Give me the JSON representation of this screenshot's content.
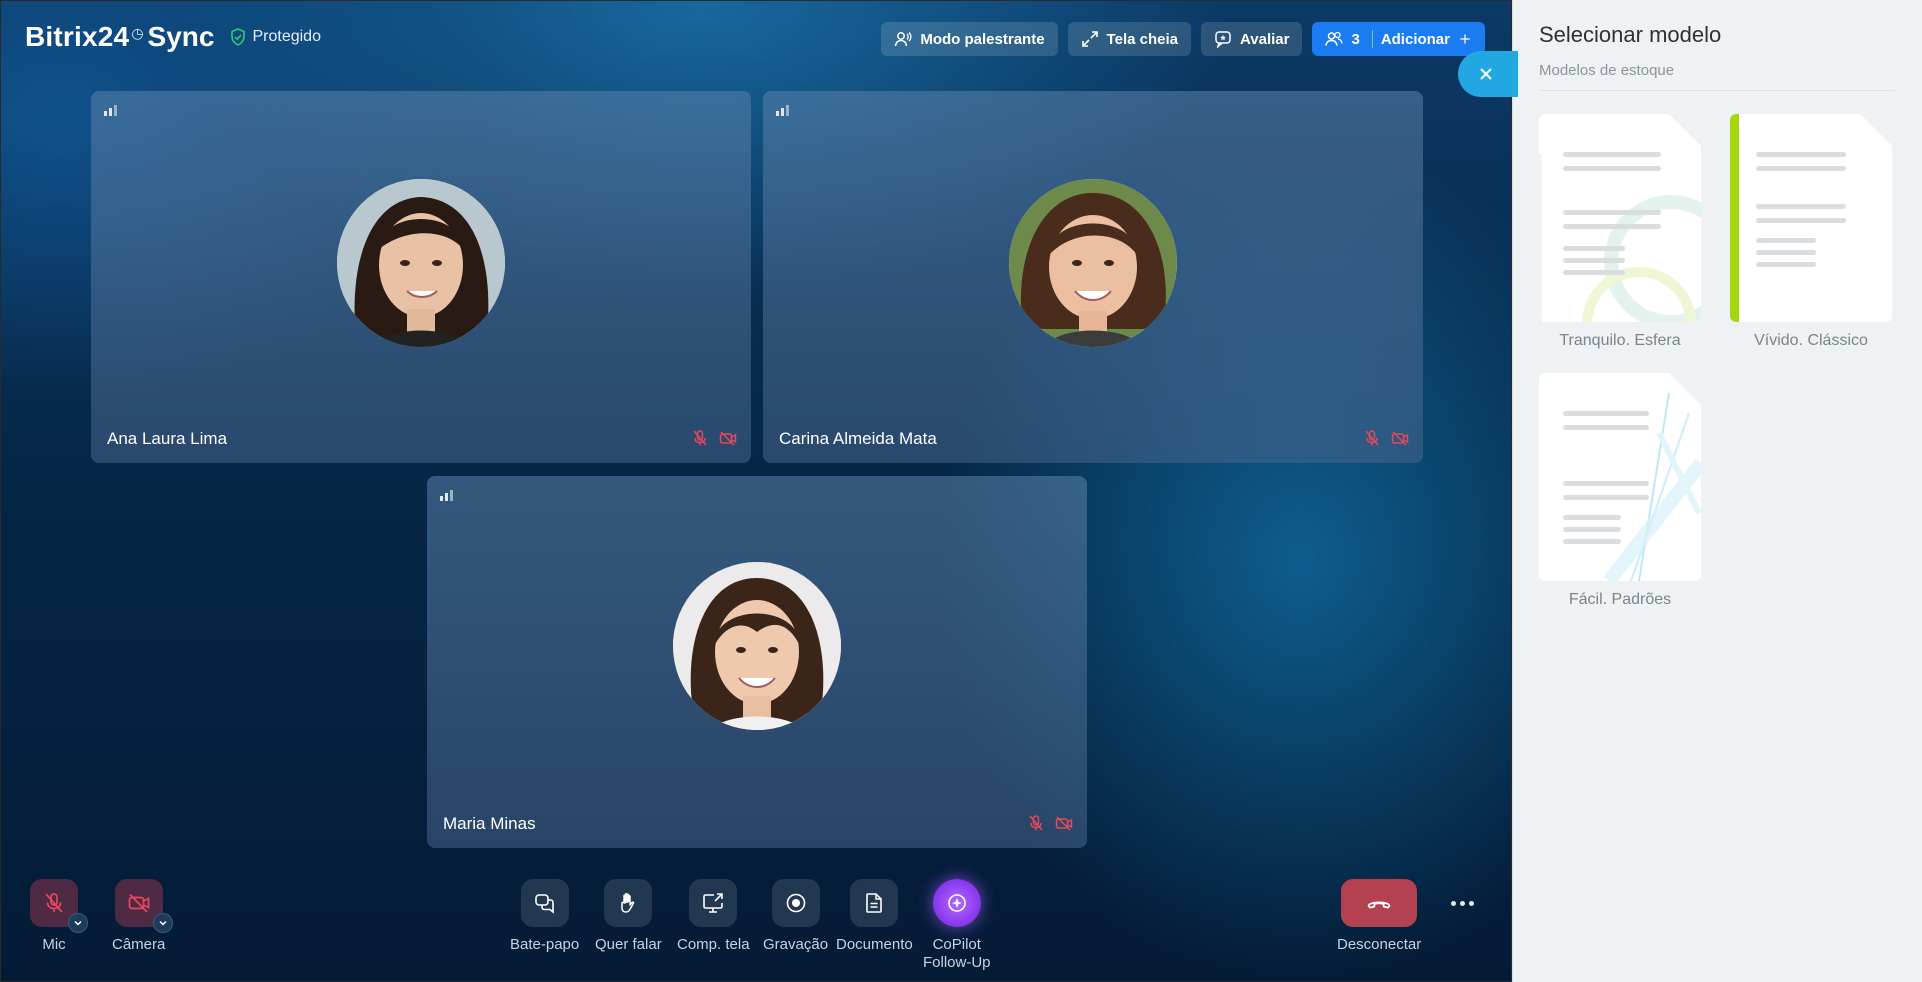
{
  "app": {
    "brand_name": "Bitrix24",
    "brand_suffix": "Sync",
    "security_label": "Protegido"
  },
  "header": {
    "speaker_mode": "Modo palestrante",
    "fullscreen": "Tela cheia",
    "rate": "Avaliar",
    "participants_count": "3",
    "add": "Adicionar"
  },
  "participants": [
    {
      "name": "Ana Laura Lima",
      "mic_muted": true,
      "camera_off": true
    },
    {
      "name": "Carina Almeida Mata",
      "mic_muted": true,
      "camera_off": true
    },
    {
      "name": "Maria Minas",
      "mic_muted": true,
      "camera_off": true
    }
  ],
  "controls": {
    "mic": "Mic",
    "camera": "Câmera",
    "chat": "Bate-papo",
    "raise_hand": "Quer falar",
    "share_screen": "Comp. tela",
    "recording": "Gravação",
    "document": "Documento",
    "copilot_line1": "CoPilot",
    "copilot_line2": "Follow-Up",
    "disconnect": "Desconectar"
  },
  "panel": {
    "title": "Selecionar modelo",
    "subtitle": "Modelos de estoque",
    "templates": [
      {
        "label": "Tranquilo. Esfera",
        "accent": "#c6e84a"
      },
      {
        "label": "Vívido. Clássico",
        "accent": "#a5d80a"
      },
      {
        "label": "Fácil. Padrões",
        "accent": "#bfe6f7"
      }
    ]
  },
  "colors": {
    "primary": "#1a7cf0",
    "close_button": "#21a8e3",
    "muted_red": "#e8485c",
    "hangup": "#b4414f",
    "copilot": "#8d3cf0"
  }
}
